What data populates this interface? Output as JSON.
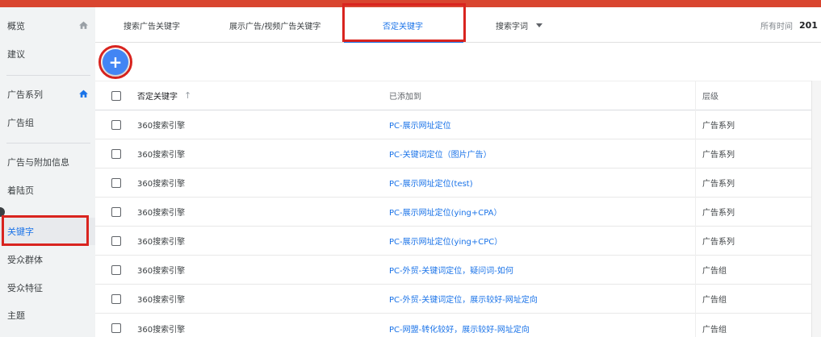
{
  "sidebar": {
    "items": [
      {
        "label": "概览",
        "home": true
      },
      {
        "label": "建议",
        "home": false
      },
      {
        "label": "广告系列",
        "home": true
      },
      {
        "label": "广告组",
        "home": false
      },
      {
        "label": "广告与附加信息",
        "home": false
      },
      {
        "label": "着陆页",
        "home": false
      },
      {
        "label": "关键字",
        "home": false,
        "active": true
      },
      {
        "label": "受众群体",
        "home": false
      },
      {
        "label": "受众特征",
        "home": false
      },
      {
        "label": "主题",
        "home": false
      }
    ]
  },
  "tabs": [
    {
      "label": "搜索广告关键字"
    },
    {
      "label": "展示广告/视频广告关键字"
    },
    {
      "label": "否定关键字",
      "selected": true
    },
    {
      "label": "搜索字词",
      "dropdown": true
    }
  ],
  "time": {
    "label": "所有时间",
    "value": "201"
  },
  "add_button": {
    "symbol": "+"
  },
  "table": {
    "headers": {
      "keyword": "否定关键字",
      "sort_arrow": "↑",
      "added_to": "已添加到",
      "level": "层级"
    },
    "rows": [
      {
        "keyword": "360搜索引擎",
        "added_to": "PC-展示网址定位",
        "level": "广告系列"
      },
      {
        "keyword": "360搜索引擎",
        "added_to": "PC-关键词定位（图片广告）",
        "level": "广告系列"
      },
      {
        "keyword": "360搜索引擎",
        "added_to": "PC-展示网址定位(test)",
        "level": "广告系列"
      },
      {
        "keyword": "360搜索引擎",
        "added_to": "PC-展示网址定位(ying+CPA）",
        "level": "广告系列"
      },
      {
        "keyword": "360搜索引擎",
        "added_to": "PC-展示网址定位(ying+CPC）",
        "level": "广告系列"
      },
      {
        "keyword": "360搜索引擎",
        "added_to": "PC-外贸-关键词定位，疑问词-如何",
        "level": "广告组"
      },
      {
        "keyword": "360搜索引擎",
        "added_to": "PC-外贸-关键词定位，展示较好-网址定向",
        "level": "广告组"
      },
      {
        "keyword": "360搜索引擎",
        "added_to": "PC-网盟-转化较好，展示较好-网址定向",
        "level": "广告组"
      }
    ]
  },
  "colors": {
    "accent": "#1a73e8",
    "brand_bar": "#d9452f",
    "highlight_box": "#d9241f",
    "fab": "#4285f4"
  }
}
